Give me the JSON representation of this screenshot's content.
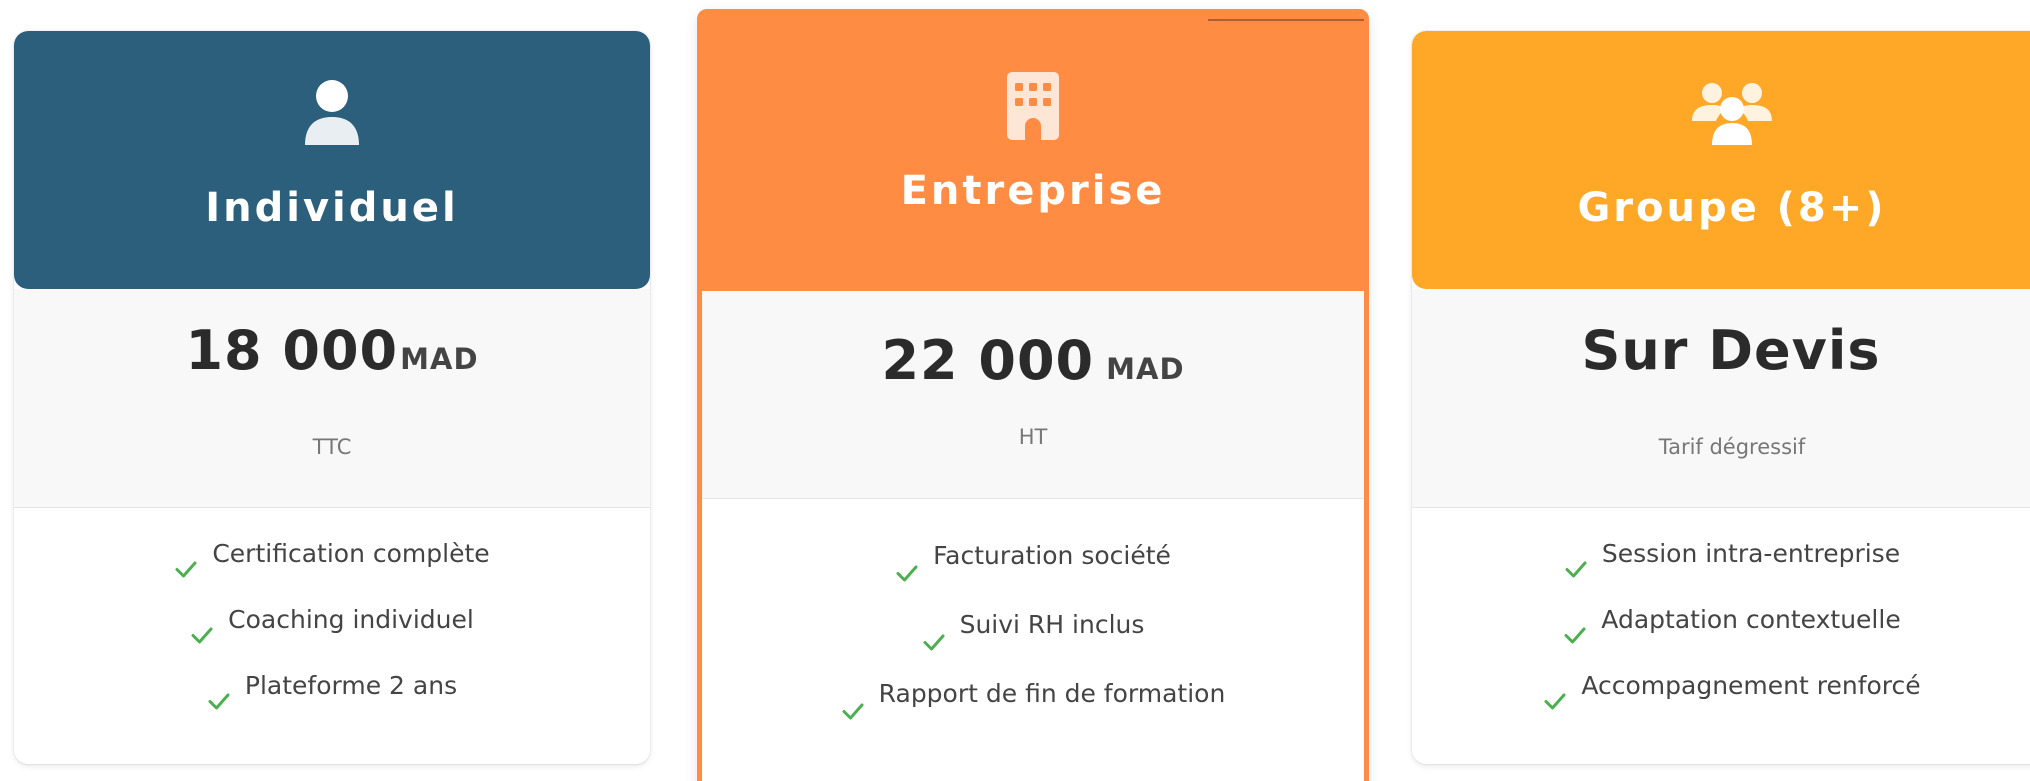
{
  "plans": [
    {
      "title": "Individuel",
      "icon": "user-icon",
      "header_color": "#2c5f7c",
      "price_amount": "18 000",
      "price_currency": "MAD",
      "price_note": "TTC",
      "features": [
        "Certification complète",
        "Coaching individuel",
        "Plateforme 2 ans"
      ]
    },
    {
      "title": "Entreprise",
      "icon": "building-icon",
      "header_color": "#ff8c42",
      "price_amount": "22 000",
      "price_currency": "MAD",
      "price_note": "HT",
      "features": [
        "Facturation société",
        "Suivi RH inclus",
        "Rapport de fin de formation"
      ]
    },
    {
      "title": "Groupe (8+)",
      "icon": "users-group-icon",
      "header_color": "#ffa726",
      "price_amount": "Sur Devis",
      "price_currency": "",
      "price_note": "Tarif dégressif",
      "features": [
        "Session intra-entreprise",
        "Adaptation contextuelle",
        "Accompagnement renforcé"
      ]
    }
  ],
  "colors": {
    "check": "#4caf50",
    "price_text": "#2b2b2b",
    "feature_text": "#444444"
  }
}
